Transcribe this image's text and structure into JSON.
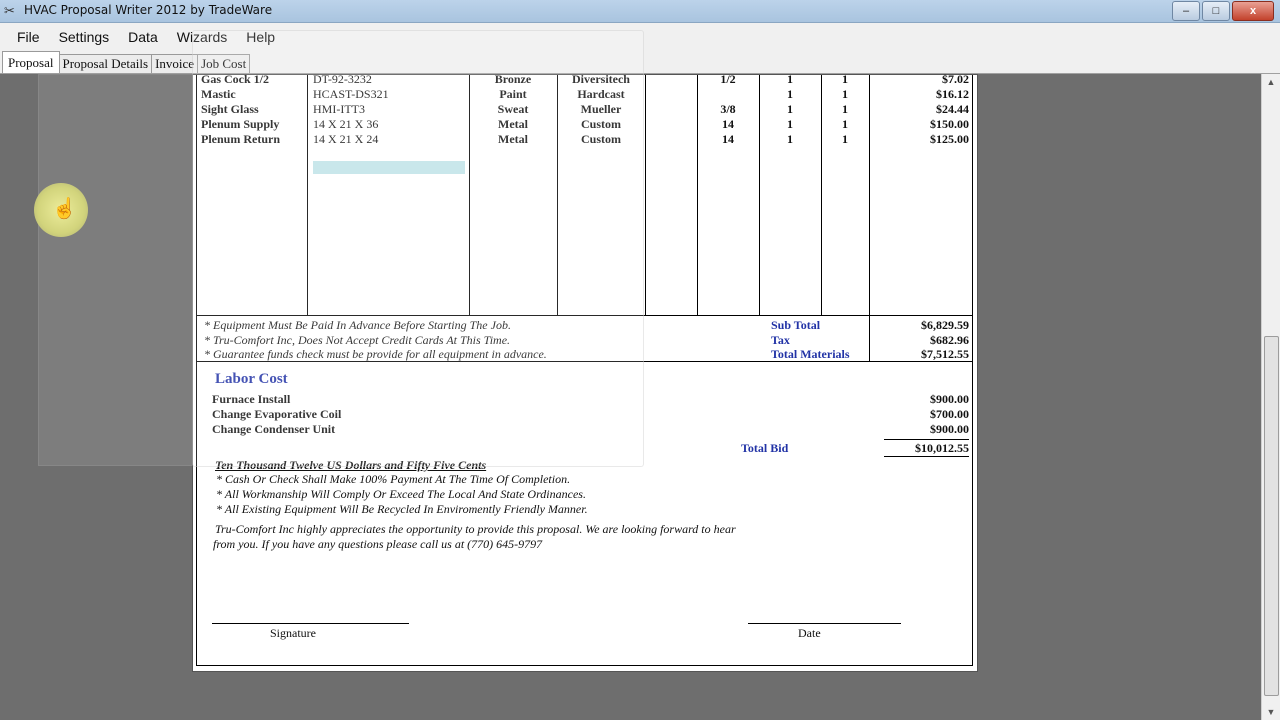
{
  "window": {
    "title": "HVAC Proposal Writer 2012 by TradeWare",
    "minimize": "–",
    "restore": "□",
    "close": "x"
  },
  "menu": [
    "File",
    "Settings",
    "Data",
    "Wizards",
    "Help"
  ],
  "tabs": [
    "Proposal",
    "Proposal Details",
    "Invoice",
    "Job Cost"
  ],
  "materials": [
    {
      "item": "Gas Cock 1/2",
      "part": "DT-92-3232",
      "type": "Bronze",
      "brand": "Diversitech",
      "size": "1/2",
      "qty1": "1",
      "qty2": "1",
      "price": "$7.02"
    },
    {
      "item": "Mastic",
      "part": "HCAST-DS321",
      "type": "Paint",
      "brand": "Hardcast",
      "size": "",
      "qty1": "1",
      "qty2": "1",
      "price": "$16.12"
    },
    {
      "item": "Sight Glass",
      "part": "HMI-ITT3",
      "type": "Sweat",
      "brand": "Mueller",
      "size": "3/8",
      "qty1": "1",
      "qty2": "1",
      "price": "$24.44"
    },
    {
      "item": "Plenum Supply",
      "part": "14 X 21 X 36",
      "type": "Metal",
      "brand": "Custom",
      "size": "14",
      "qty1": "1",
      "qty2": "1",
      "price": "$150.00"
    },
    {
      "item": "Plenum Return",
      "part": "14 X 21 X 24",
      "type": "Metal",
      "brand": "Custom",
      "size": "14",
      "qty1": "1",
      "qty2": "1",
      "price": "$125.00"
    }
  ],
  "notes": [
    "* Equipment Must Be Paid In Advance Before Starting The Job.",
    "* Tru-Comfort Inc, Does Not Accept Credit Cards At This Time.",
    "* Guarantee funds check must be provide for all equipment in advance."
  ],
  "totals": {
    "subtotal_label": "Sub Total",
    "subtotal": "$6,829.59",
    "tax_label": "Tax",
    "tax": "$682.96",
    "materials_label": "Total Materials",
    "materials": "$7,512.55"
  },
  "labor": {
    "heading": "Labor Cost",
    "items": [
      {
        "name": "Furnace Install",
        "price": "$900.00"
      },
      {
        "name": "Change Evaporative Coil",
        "price": "$700.00"
      },
      {
        "name": "Change Condenser Unit",
        "price": "$900.00"
      }
    ],
    "total_bid_label": "Total Bid",
    "total_bid": "$10,012.55"
  },
  "amount_words": "Ten Thousand Twelve US Dollars and Fifty Five Cents",
  "terms": [
    "* Cash Or Check Shall Make 100% Payment At The Time Of Completion.",
    "* All Workmanship Will Comply Or Exceed The Local And State Ordinances.",
    "* All Existing Equipment Will Be Recycled In Enviromently Friendly Manner."
  ],
  "closing_line1": "Tru-Comfort Inc highly appreciates the opportunity to provide this proposal. We are looking forward to hear",
  "closing_line2": "from you. If you have any questions please call us at (770) 645-9797",
  "signature_label": "Signature",
  "date_label": "Date"
}
